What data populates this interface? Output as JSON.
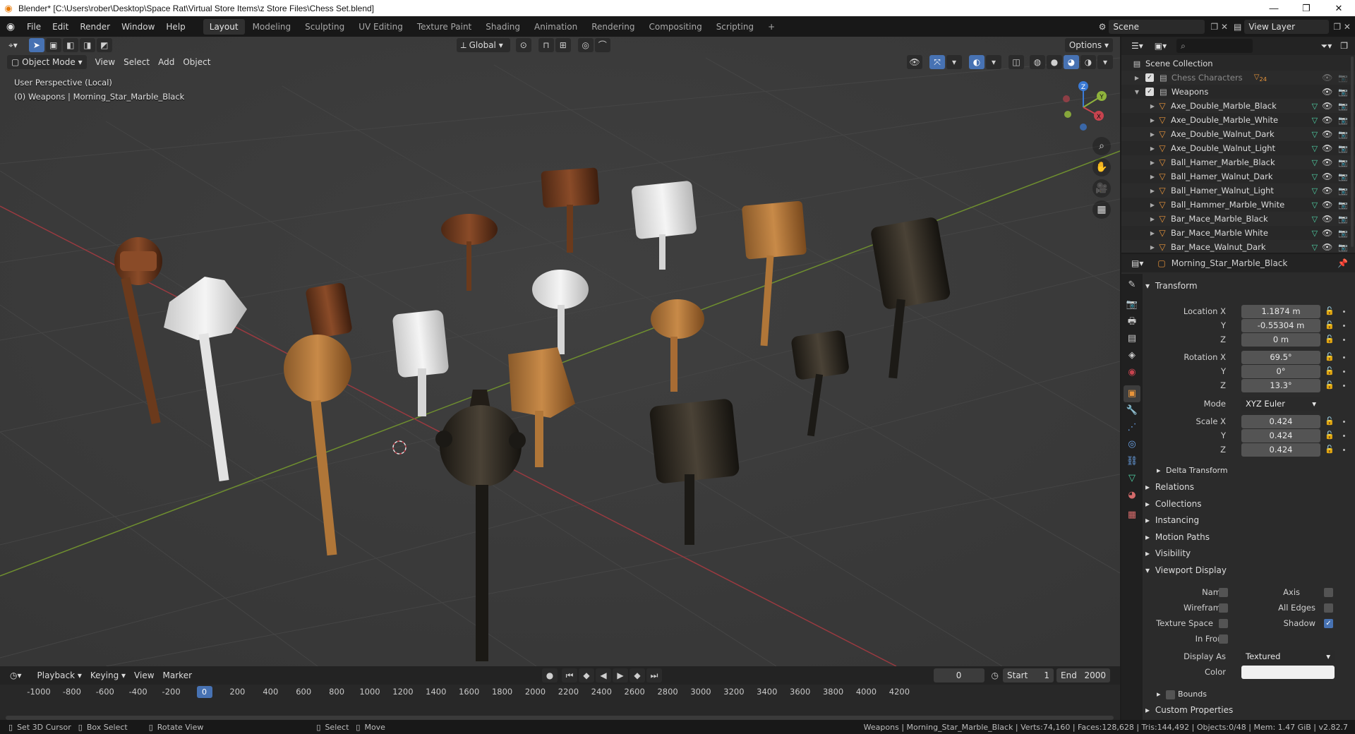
{
  "title_bar": {
    "title": "Blender* [C:\\Users\\rober\\Desktop\\Space Rat\\Virtual Store Items\\z Store Files\\Chess Set.blend]"
  },
  "menu": [
    "File",
    "Edit",
    "Render",
    "Window",
    "Help"
  ],
  "workspaces": [
    "Layout",
    "Modeling",
    "Sculpting",
    "UV Editing",
    "Texture Paint",
    "Shading",
    "Animation",
    "Rendering",
    "Compositing",
    "Scripting"
  ],
  "active_workspace": "Layout",
  "scene": "Scene",
  "view_layer": "View Layer",
  "viewport": {
    "transform_orientation": "Global",
    "options_label": "Options",
    "mode": "Object Mode",
    "menus": [
      "View",
      "Select",
      "Add",
      "Object"
    ],
    "view_name": "User Perspective (Local)",
    "object_info": "(0) Weapons | Morning_Star_Marble_Black",
    "gizmo": {
      "x": "X",
      "y": "Y",
      "z": "Z"
    }
  },
  "timeline": {
    "menus": [
      "Playback",
      "Keying",
      "View",
      "Marker"
    ],
    "current_frame": "0",
    "start_label": "Start",
    "start": "1",
    "end_label": "End",
    "end": "2000",
    "ruler": [
      "-1000",
      "-800",
      "-600",
      "-400",
      "-200",
      "0",
      "200",
      "400",
      "600",
      "800",
      "1000",
      "1200",
      "1400",
      "1600",
      "1800",
      "2000",
      "2200",
      "2400",
      "2600",
      "2800",
      "3000",
      "3200",
      "3400",
      "3600",
      "3800",
      "4000",
      "4200"
    ],
    "cursor": "0"
  },
  "status": {
    "left": [
      "Set 3D Cursor",
      "Box Select",
      "Rotate View",
      "Select",
      "Move"
    ],
    "right": "Weapons | Morning_Star_Marble_Black | Verts:74,160 | Faces:128,628 | Tris:144,492 | Objects:0/48 | Mem: 1.47 GiB | v2.82.7"
  },
  "outliner": {
    "root": "Scene Collection",
    "collections": [
      {
        "name": "Chess Characters",
        "count": "24"
      },
      {
        "name": "Weapons"
      }
    ],
    "items": [
      "Axe_Double_Marble_Black",
      "Axe_Double_Marble_White",
      "Axe_Double_Walnut_Dark",
      "Axe_Double_Walnut_Light",
      "Ball_Hamer_Marble_Black",
      "Ball_Hamer_Walnut_Dark",
      "Ball_Hamer_Walnut_Light",
      "Ball_Hammer_Marble_White",
      "Bar_Mace_Marble_Black",
      "Bar_Mace_Marble White",
      "Bar_Mace_Walnut_Dark"
    ]
  },
  "properties": {
    "object_name": "Morning_Star_Marble_Black",
    "transform_title": "Transform",
    "location_label": "Location X",
    "location": [
      "1.1874 m",
      "-0.55304 m",
      "0 m"
    ],
    "rotation_label": "Rotation X",
    "rotation": [
      "69.5°",
      "0°",
      "13.3°"
    ],
    "mode_label": "Mode",
    "mode": "XYZ Euler",
    "scale_label": "Scale X",
    "scale": [
      "0.424",
      "0.424",
      "0.424"
    ],
    "axis_labels": [
      "Y",
      "Z"
    ],
    "delta": "Delta Transform",
    "sections": [
      "Relations",
      "Collections",
      "Instancing",
      "Motion Paths",
      "Visibility"
    ],
    "viewport_display": "Viewport Display",
    "vd": {
      "name": "Name",
      "axis": "Axis",
      "wireframe": "Wireframe",
      "all_edges": "All Edges",
      "texture_space": "Texture Space",
      "shadow": "Shadow",
      "in_front": "In Front",
      "display_as_label": "Display As",
      "display_as": "Textured",
      "color_label": "Color"
    },
    "bounds": "Bounds",
    "custom_properties": "Custom Properties"
  },
  "colors": {
    "accent": "#4772b3",
    "orange": "#e8943a",
    "green_axis": "#8fb33c",
    "red_axis": "#c7434e"
  }
}
